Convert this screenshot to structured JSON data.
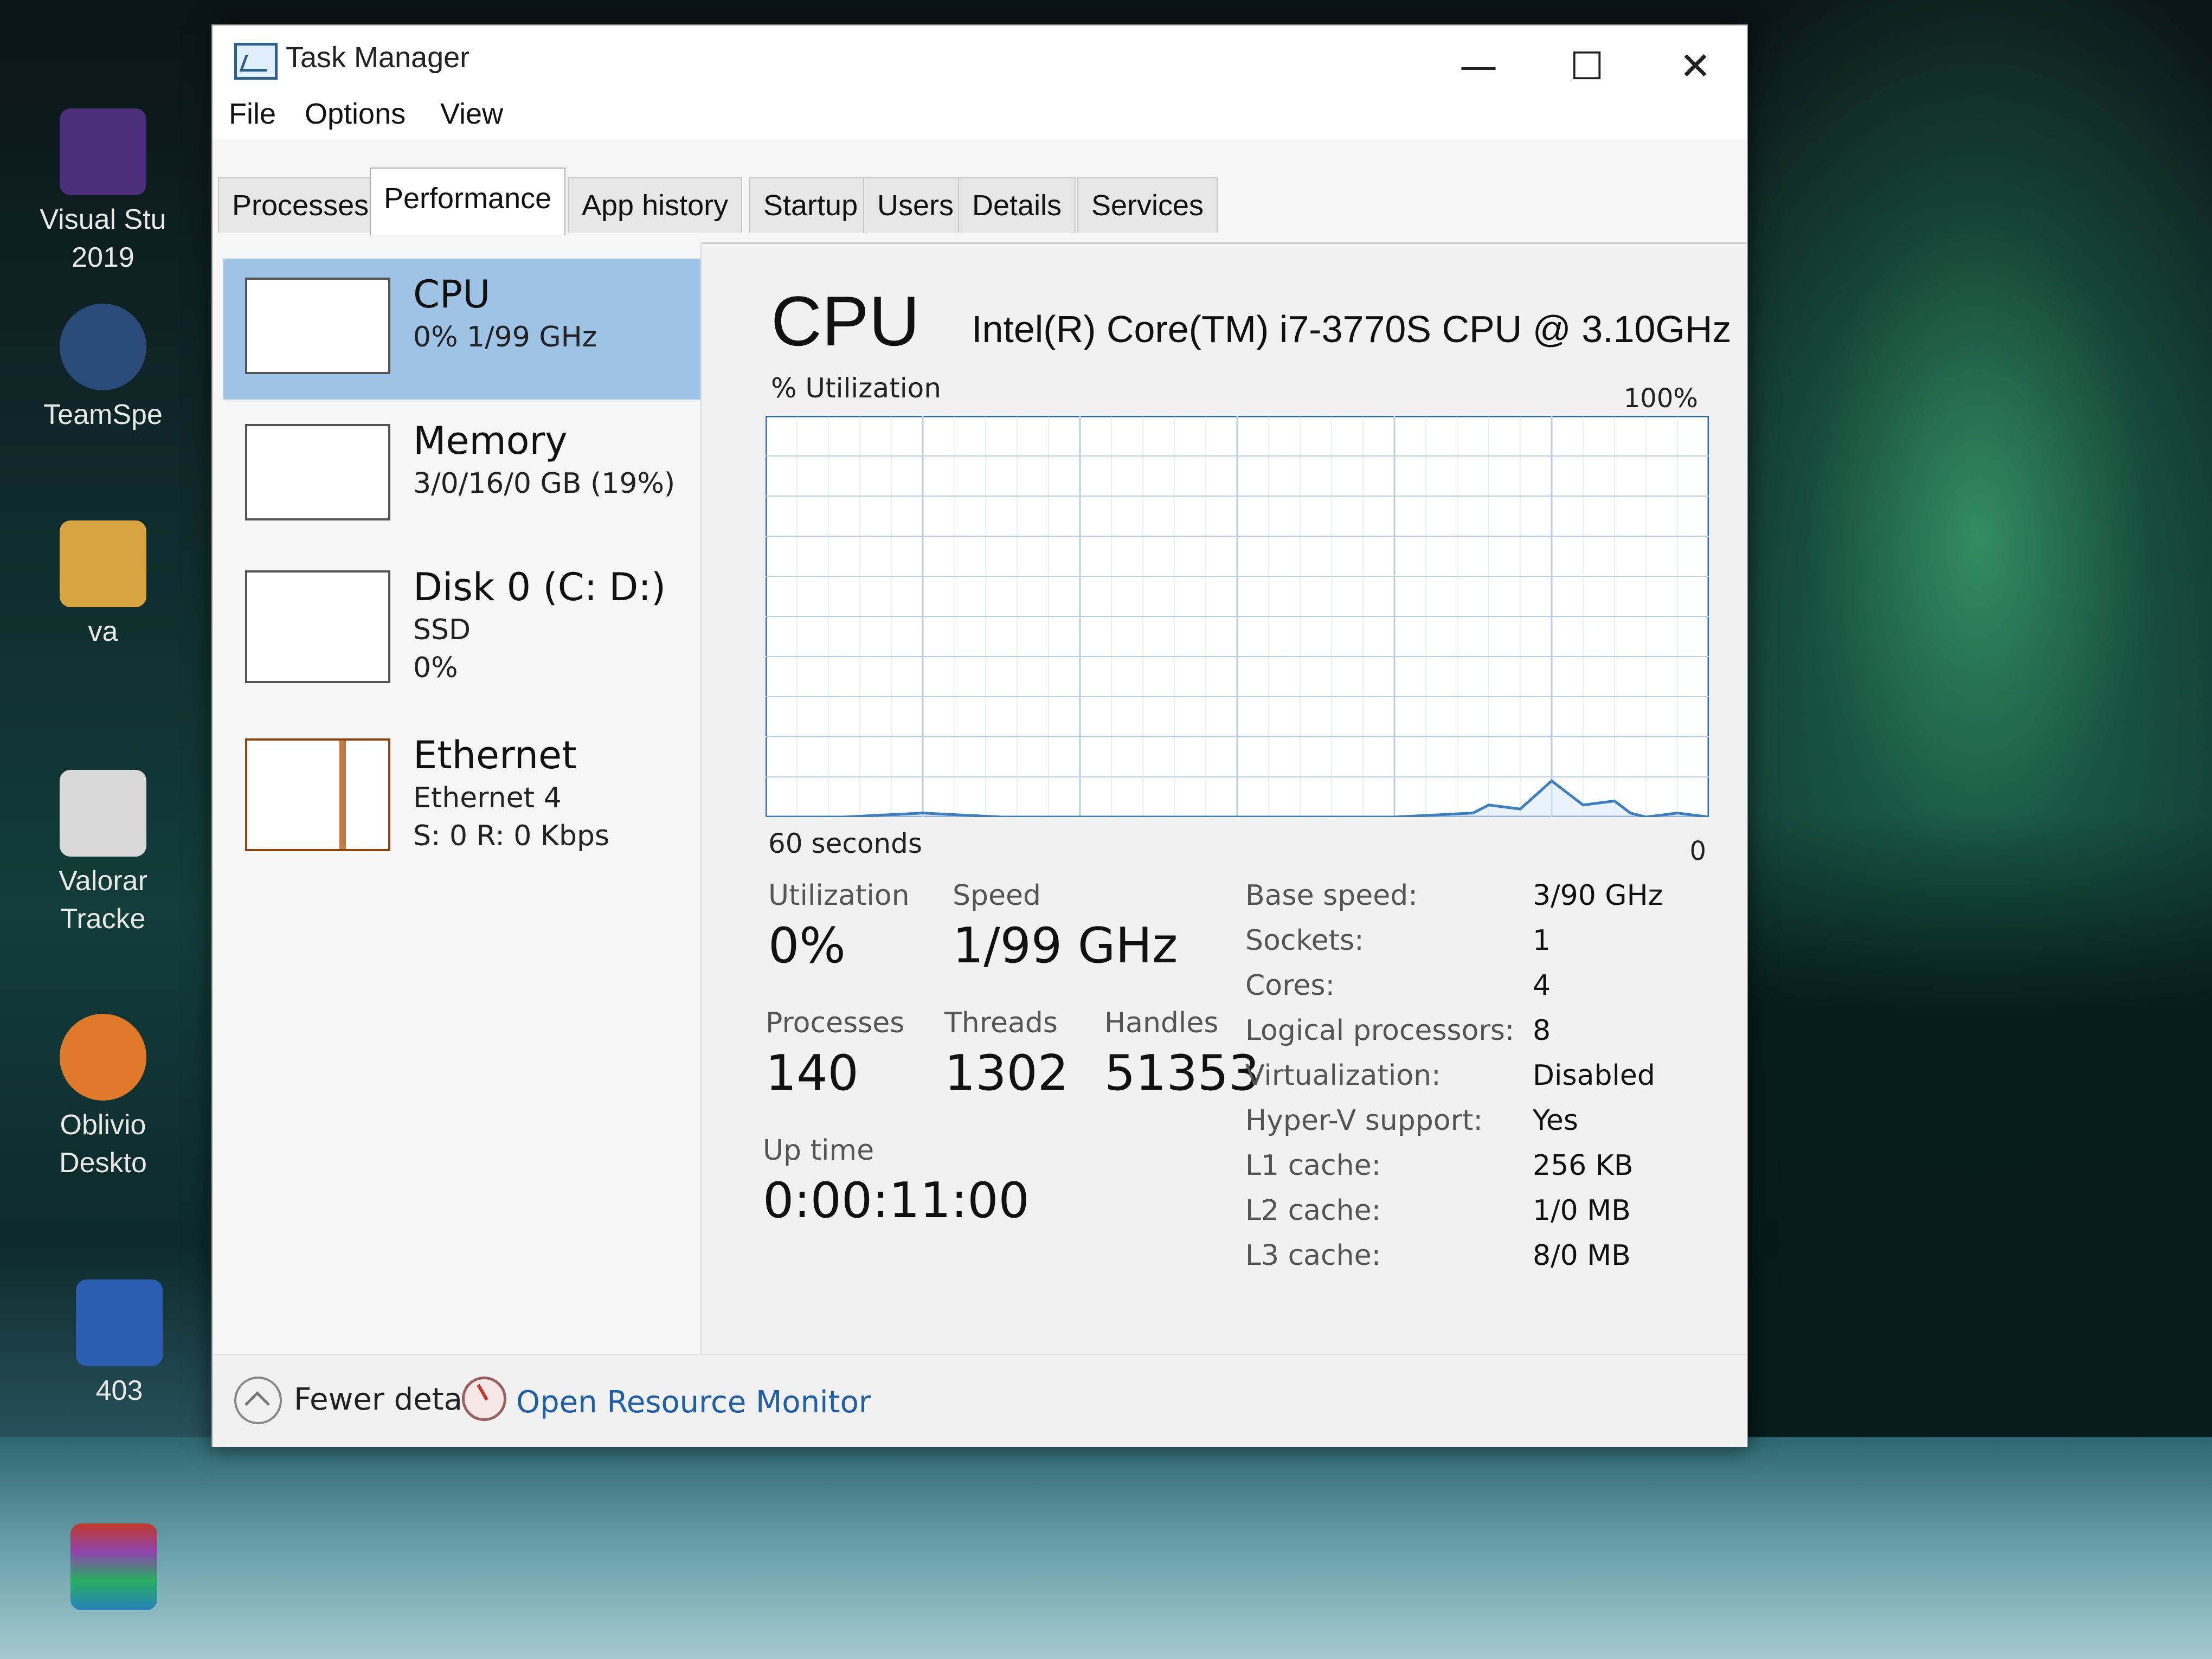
{
  "desktop": {
    "icons": [
      {
        "label": "Visual Stu 2019"
      },
      {
        "label": "TeamSpe"
      },
      {
        "label": "va"
      },
      {
        "label": "Valorar Tracke"
      },
      {
        "label": "Oblivio Deskto"
      },
      {
        "label": "403"
      }
    ]
  },
  "window": {
    "title": "Task Manager",
    "controls": {
      "minimize": "—",
      "maximize": "☐",
      "close": "✕"
    }
  },
  "menu": {
    "file": "File",
    "options": "Options",
    "view": "View"
  },
  "tabs": [
    {
      "label": "Processes"
    },
    {
      "label": "Performance",
      "active": true
    },
    {
      "label": "App history"
    },
    {
      "label": "Startup"
    },
    {
      "label": "Users"
    },
    {
      "label": "Details"
    },
    {
      "label": "Services"
    }
  ],
  "resources": {
    "cpu": {
      "name": "CPU",
      "sub1": "0%  1/99 GHz"
    },
    "memory": {
      "name": "Memory",
      "sub1": "3/0/16/0 GB (19%)"
    },
    "disk": {
      "name": "Disk 0 (C: D:)",
      "sub1": "SSD",
      "sub2": "0%"
    },
    "ethernet": {
      "name": "Ethernet",
      "sub1": "Ethernet 4",
      "sub2": "S: 0 R: 0 Kbps"
    }
  },
  "detail": {
    "title": "CPU",
    "model": "Intel(R) Core(TM) i7-3770S CPU @ 3.10GHz",
    "util_label": "% Utilization",
    "util_max": "100%",
    "time_label": "60 seconds",
    "zero_label": "0",
    "stats": {
      "utilization": {
        "label": "Utilization",
        "value": "0%"
      },
      "speed": {
        "label": "Speed",
        "value": "1/99 GHz"
      },
      "processes": {
        "label": "Processes",
        "value": "140"
      },
      "threads": {
        "label": "Threads",
        "value": "1302"
      },
      "handles": {
        "label": "Handles",
        "value": "51353"
      },
      "uptime": {
        "label": "Up time",
        "value": "0:00:11:00"
      }
    },
    "specs": [
      {
        "label": "Base speed:",
        "value": "3/90 GHz"
      },
      {
        "label": "Sockets:",
        "value": "1"
      },
      {
        "label": "Cores:",
        "value": "4"
      },
      {
        "label": "Logical processors:",
        "value": "8"
      },
      {
        "label": "Virtualization:",
        "value": "Disabled"
      },
      {
        "label": "Hyper-V support:",
        "value": "Yes"
      },
      {
        "label": "L1 cache:",
        "value": "256 KB"
      },
      {
        "label": "L2 cache:",
        "value": "1/0 MB"
      },
      {
        "label": "L3 cache:",
        "value": "8/0 MB"
      }
    ]
  },
  "footer": {
    "fewer_details": "Fewer details",
    "open_resource_monitor": "Open Resource Monitor"
  },
  "colors": {
    "graph_line": "#3f7fbf",
    "graph_grid": "#b8cfe6",
    "graph_border": "#2f6aa8",
    "selected": "#9fc3e6",
    "link": "#1f5fa8"
  },
  "chart_data": {
    "type": "line",
    "ylabel": "% Utilization",
    "ylim": [
      0,
      100
    ],
    "xlabel": "60 seconds",
    "x": [
      0,
      5,
      10,
      15,
      20,
      25,
      30,
      35,
      40,
      45,
      46,
      48,
      50,
      52,
      54,
      55,
      56,
      58,
      60
    ],
    "values": [
      0,
      0,
      1,
      0,
      0,
      0,
      0,
      0,
      0,
      1,
      3,
      2,
      9,
      3,
      4,
      1,
      0,
      1,
      0
    ]
  }
}
